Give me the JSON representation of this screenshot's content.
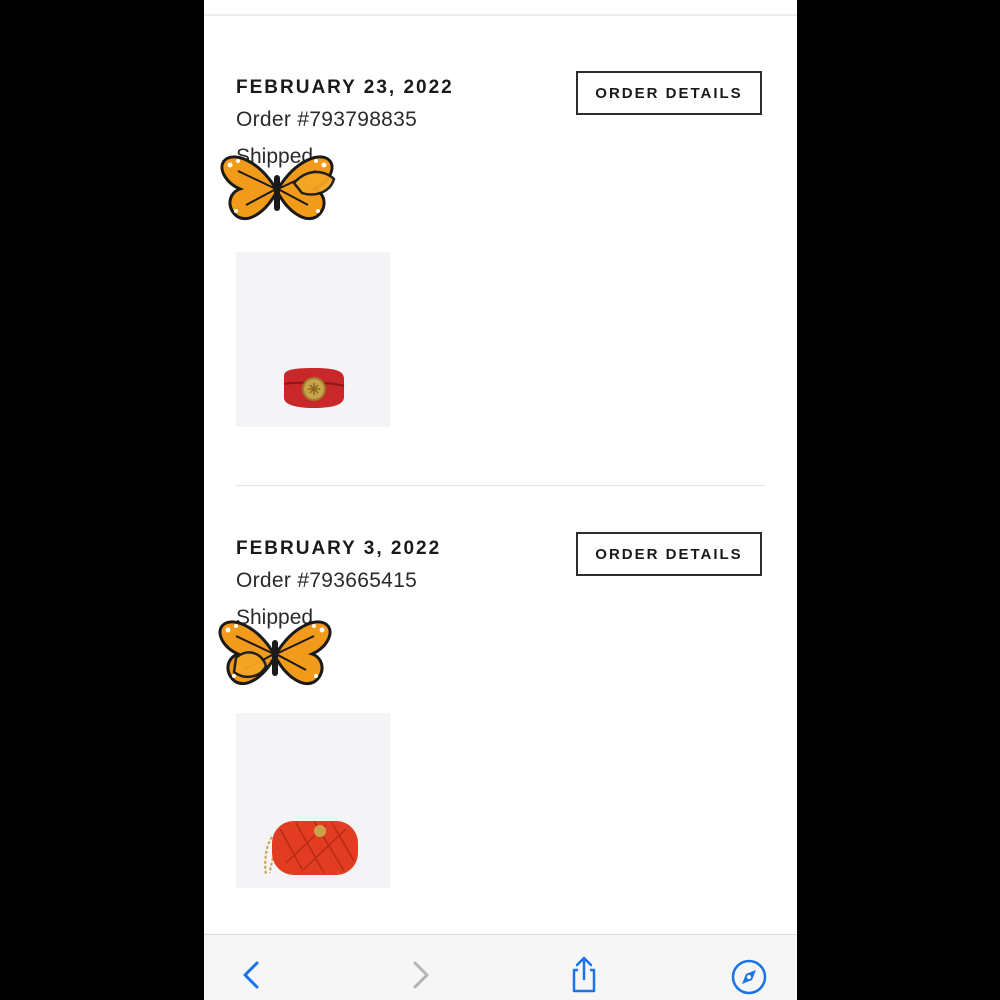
{
  "orders": [
    {
      "date": "FEBRUARY 23, 2022",
      "order_number": "Order #793798835",
      "status": "Shipped",
      "details_label": "ORDER DETAILS",
      "product_icon": "red-leather-belt-with-gold-logo"
    },
    {
      "date": "FEBRUARY 3, 2022",
      "order_number": "Order #793665415",
      "status": "Shipped",
      "details_label": "ORDER DETAILS",
      "product_icon": "red-quilted-camera-bag"
    }
  ],
  "stickers": [
    "monarch-butterfly-icon",
    "monarch-butterfly-icon"
  ],
  "toolbar": {
    "icons": [
      "back-arrow-icon",
      "forward-arrow-icon",
      "share-icon",
      "safari-compass-icon"
    ]
  },
  "colors": {
    "accent": "#1a73e8",
    "disabled": "#b5b5b5",
    "product_red": "#c8282a",
    "bag_red": "#e23c22",
    "gold": "#c9a24a"
  }
}
